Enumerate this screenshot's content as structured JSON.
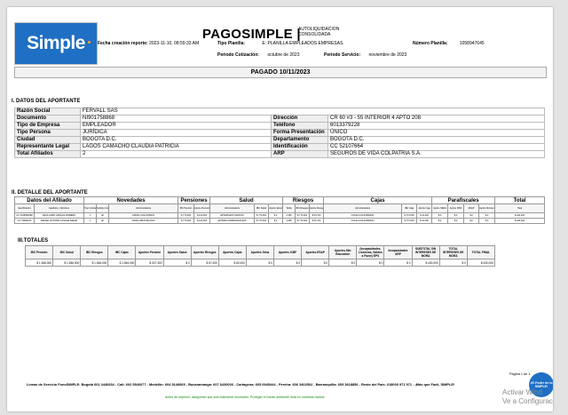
{
  "brand": "PAGOSIMPLE |",
  "logo_text": "Simple",
  "autoliq": [
    "AUTOLIQUIDACION",
    "CONSOLIDADA"
  ],
  "header": {
    "fecha_label": "Fecha creación reporte:",
    "fecha_value": "2023-11-10, 08:59:33 AM",
    "tipo_planilla_label": "Tipo Planilla:",
    "tipo_planilla_value": "E: PLANILLA EMPLEADOS EMPRESAS.",
    "numero_planilla_label": "Número Planilla:",
    "numero_planilla_value": "1058947645",
    "periodo_cot_label": "Periodo Cotización:",
    "periodo_cot_value": "octubre de 2023",
    "periodo_serv_label": "Periodo Servicio:",
    "periodo_serv_value": "noviembre de 2023"
  },
  "pagado": "PAGADO 10/11/2023",
  "sections": {
    "aportante": "I. DATOS DEL APORTANTE",
    "detalle": "II. DETALLE DEL APORTANTE",
    "totales": "III.TOTALES"
  },
  "aportante": {
    "razon_label": "Razón Social",
    "razon_value": "FERVALL SAS",
    "doc_label": "Documento",
    "doc_value": "NI901758868",
    "dir_label": "Dirección",
    "dir_value": "CR 60 #3 - 55 INTERIOR 4 APTO 208",
    "tipo_emp_label": "Tipo de Empresa",
    "tipo_emp_value": "EMPLEADOR",
    "tel_label": "Teléfono",
    "tel_value": "6013379228",
    "tipo_per_label": "Tipo Persona",
    "tipo_per_value": "JURÍDICA",
    "forma_label": "Forma Presentación",
    "forma_value": "ÚNICO",
    "ciudad_label": "Ciudad",
    "ciudad_value": "BOGOTA D.C.",
    "depto_label": "Departamento",
    "depto_value": "BOGOTA D.C.",
    "rep_label": "Representante Legal",
    "rep_value": "LAGOS CAMACHO CLAUDIA PATRICIA",
    "ident_label": "Identificación",
    "ident_value": "CC 52107664",
    "afil_label": "Total Afiliados",
    "afil_value": "2",
    "arp_label": "ARP",
    "arp_value": "SEGUROS DE VIDA COLPATRIA S.A."
  },
  "detalle": {
    "groups": [
      "Datos del Afiliado",
      "Novedades",
      "Pensiones",
      "Salud",
      "Riesgos",
      "Cajas",
      "Parafiscales",
      "Total"
    ],
    "sub": [
      "Identificación",
      "Apellidos y Nombres",
      "Tipo Cotizante",
      "Subtipo Cotizante",
      "Administradora",
      "IBC Pensión",
      "Aporte Pensión",
      "Administradora",
      "IBC Salud",
      "Aporte Salud",
      "Tarifa",
      "IBC Riesgos",
      "Aporte Riesgos",
      "Administradora",
      "IBC Caja",
      "Aporte Caja",
      "Aporte SENA",
      "Aporte ICBF",
      "ESAP",
      "Aporte Ministerio",
      "Total"
    ],
    "rows": [
      [
        "CC 1018456388",
        "ANZA JAIRO VARGAS ROMERO",
        "1",
        "00",
        "230301-COLFONDOS",
        "$ 773.000",
        "$ 124.000",
        "EPS005-EPS SANITAS",
        "$ 773.000",
        "$ 0",
        "4.350",
        "$ 773.000",
        "$ 33.700",
        "CCF22-COLSUBSIDIO",
        "$ 773.000",
        "$ 31.000",
        "$ 0",
        "$ 0",
        "$ 0",
        "$ 0",
        "$ 224.300"
      ],
      [
        "CC 79060183",
        "RAFAEL ANTONIO LOSADA SAENZ",
        "1",
        "00",
        "230201-PROTECCION",
        "$ 773.000",
        "$ 124.000",
        "EPS008-COMPENSAR EPS",
        "$ 773.000",
        "$ 0",
        "4.350",
        "$ 773.000",
        "$ 33.700",
        "CCF22-COLSUBSIDIO",
        "$ 773.000",
        "$ 31.000",
        "$ 0",
        "$ 0",
        "$ 0",
        "$ 0",
        "$ 224.300"
      ]
    ]
  },
  "totales": {
    "headers": [
      "IBC Pensión",
      "IBC Salud",
      "IBC Riesgos",
      "IBC Cajas",
      "Aportes Pensión",
      "Aportes Salud",
      "Aportes Riesgos",
      "Aportes Cajas",
      "Aportes Sena",
      "Aportes ICBF",
      "Aportes ESAP",
      "Aportes Min Educación",
      "(Incapacidades, Licencias, Saldos a Favor) EPS",
      "Incapacidades ARP",
      "SUBTOTAL SIN INTERESES DE MORA",
      "TOTAL INTERESES DE MORA",
      "TOTAL FINAL"
    ],
    "values": [
      "$ 1.546.000",
      "$ 1.546.000",
      "$ 1.546.000",
      "$ 1.546.000",
      "$ 247.400",
      "$ 0",
      "$ 67.400",
      "$ 62.000",
      "$ 0",
      "$ 0",
      "$ 0",
      "$ 0",
      "$ 0",
      "$ 0",
      "$ 430.000",
      "$ 0",
      "$ 430.000"
    ]
  },
  "footer": {
    "lines": "Líneas de Servicio FonoSIMPLE: Bogotá 601 4446634 - Cali: 602 5540077 - Medellín: 604 5146669 - Bucaramanga: 607 6430000 - Cartagena: 605 6945444 - Pereira: 606 3402502 - Barranquilla: 605 3618856 - Resto del País: 018000 971 971 - ¡Más que Fácil, SIMPLE!",
    "env": "Antes de imprimir, asegúrese que sea realmente necesario. Proteger el medio ambiente está en nuestras manos.",
    "page": "Página 1 de 1",
    "badge": "¡El Poder de lo SIMPLE!"
  },
  "watermark": [
    "Activar Wind",
    "Ve a Configurac"
  ]
}
